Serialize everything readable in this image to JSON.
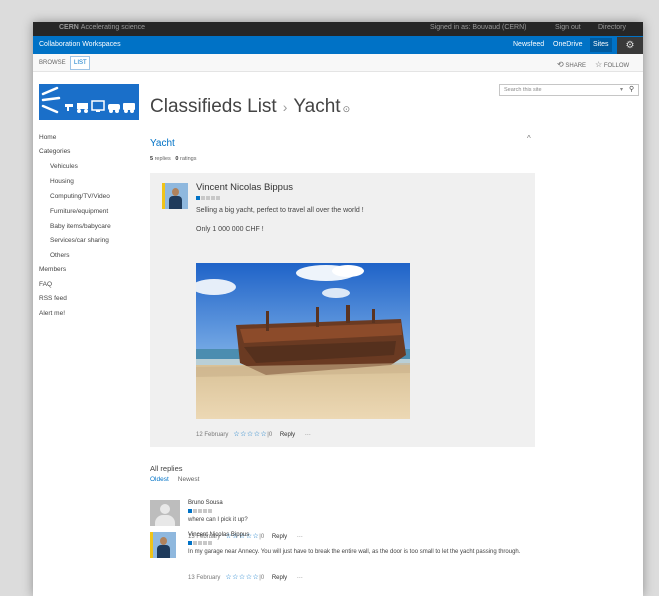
{
  "suite_bar": {
    "brand": "CERN",
    "brand_suffix": "Accelerating science",
    "signed_in": "Signed in as:  Bouvaud (CERN)",
    "sign_out": "Sign out",
    "directory": "Directory"
  },
  "nav_bar": {
    "site_title": "Collaboration Workspaces",
    "links": {
      "newsfeed": "Newsfeed",
      "onedrive": "OneDrive",
      "sites": "Sites"
    }
  },
  "ribbon": {
    "tabs": {
      "browse": "BROWSE",
      "list": "LIST"
    },
    "share": "SHARE",
    "follow": "FOLLOW"
  },
  "page": {
    "title": "Classifieds List",
    "separator": "›",
    "subtitle": "Yacht"
  },
  "search": {
    "placeholder": "Search this site"
  },
  "left_nav": {
    "home": "Home",
    "categories": "Categories",
    "subcategories": [
      "Vehicules",
      "Housing",
      "Computing/TV/Video",
      "Furniture/equipment",
      "Baby items/babycare",
      "Services/car sharing",
      "Others"
    ],
    "members": "Members",
    "faq": "FAQ",
    "rss": "RSS feed",
    "alert": "Alert me!"
  },
  "topic": {
    "title": "Yacht",
    "replies_count": "5",
    "replies_label": "replies",
    "ratings_count": "0",
    "ratings_label": "ratings"
  },
  "post": {
    "author": "Vincent Nicolas Bippus",
    "line1": "Selling a big yacht, perfect to travel all over the world  !",
    "line2": "Only 1 000 000 CHF !",
    "date": "12 February",
    "rating_stars": "☆☆☆☆☆",
    "rating_count": "0",
    "reply_label": "Reply",
    "more_label": "···"
  },
  "replies": {
    "heading": "All replies",
    "sort_oldest": "Oldest",
    "sort_newest": "Newest",
    "items": [
      {
        "author": "Bruno Sousa",
        "text": "where can I pick it up?",
        "date": "13 February",
        "rating_count": "0"
      },
      {
        "author": "Vincent Nicolas Bippus",
        "text": "In my garage near Annecy. You will just have to break the entire wall, as the door is too small to let the yacht passing through.",
        "date": "13 February",
        "rating_count": "0"
      }
    ],
    "rating_stars": "☆☆☆☆☆",
    "reply_label": "Reply",
    "more_label": "···"
  },
  "colors": {
    "accent": "#0072c6",
    "suite_bar": "#262626",
    "post_background": "#f0f0f0"
  },
  "icons": [
    "gear-icon",
    "share-icon",
    "follow-star-icon",
    "search-icon",
    "collapse-caret-icon",
    "title-info-icon",
    "logo-vehicles-icon"
  ]
}
